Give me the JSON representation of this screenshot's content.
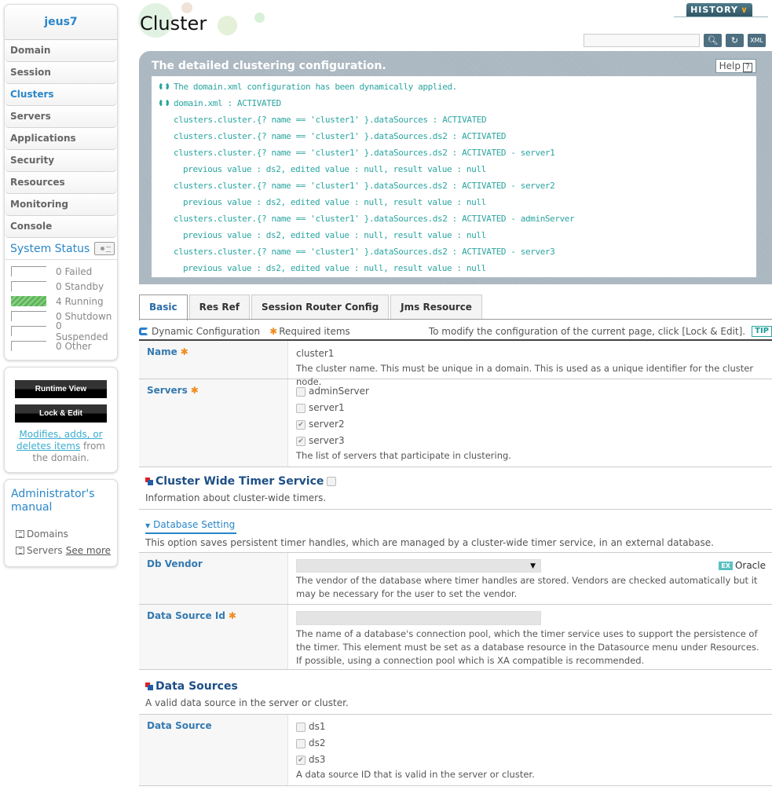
{
  "sidebar": {
    "domain_name": "jeus7",
    "nav": [
      {
        "label": "Domain",
        "active": false
      },
      {
        "label": "Session",
        "active": false
      },
      {
        "label": "Clusters",
        "active": true
      },
      {
        "label": "Servers",
        "active": false
      },
      {
        "label": "Applications",
        "active": false
      },
      {
        "label": "Security",
        "active": false
      },
      {
        "label": "Resources",
        "active": false
      },
      {
        "label": "Monitoring",
        "active": false
      },
      {
        "label": "Console",
        "active": false
      }
    ],
    "system_status": {
      "title": "System Status",
      "items": [
        {
          "count": "0",
          "label": "Failed"
        },
        {
          "count": "0",
          "label": "Standby"
        },
        {
          "count": "4",
          "label": "Running"
        },
        {
          "count": "0",
          "label": "Shutdown"
        },
        {
          "count": "0",
          "label": "Suspended"
        },
        {
          "count": "0",
          "label": "Other"
        }
      ]
    },
    "runtime_view_label": "Runtime View",
    "lock_edit_label": "Lock & Edit",
    "modify_note_link": "Modifies, adds, or deletes items",
    "modify_note_rest": " from the domain.",
    "manual": {
      "title": "Administrator's manual",
      "links": [
        "Domains",
        "Servers"
      ],
      "see_more": "See more"
    }
  },
  "header": {
    "title": "Cluster",
    "history_label": "HISTORY",
    "search_value": ""
  },
  "info_panel": {
    "title": "The detailed clustering configuration.",
    "help_label": "Help",
    "lines": [
      {
        "indent": 0,
        "icon": true,
        "text": "The domain.xml configuration has been dynamically applied."
      },
      {
        "indent": 0,
        "icon": true,
        "text": "domain.xml : ACTIVATED"
      },
      {
        "indent": 1,
        "icon": false,
        "text": "clusters.cluster.{? name == 'cluster1' }.dataSources : ACTIVATED"
      },
      {
        "indent": 1,
        "icon": false,
        "text": "clusters.cluster.{? name == 'cluster1' }.dataSources.ds2 : ACTIVATED"
      },
      {
        "indent": 1,
        "icon": false,
        "text": "clusters.cluster.{? name == 'cluster1' }.dataSources.ds2 : ACTIVATED - server1"
      },
      {
        "indent": 2,
        "icon": false,
        "text": "previous value : ds2, edited value : null, result value : null"
      },
      {
        "indent": 1,
        "icon": false,
        "text": "clusters.cluster.{? name == 'cluster1' }.dataSources.ds2 : ACTIVATED - server2"
      },
      {
        "indent": 2,
        "icon": false,
        "text": "previous value : ds2, edited value : null, result value : null"
      },
      {
        "indent": 1,
        "icon": false,
        "text": "clusters.cluster.{? name == 'cluster1' }.dataSources.ds2 : ACTIVATED - adminServer"
      },
      {
        "indent": 2,
        "icon": false,
        "text": "previous value : ds2, edited value : null, result value : null"
      },
      {
        "indent": 1,
        "icon": false,
        "text": "clusters.cluster.{? name == 'cluster1' }.dataSources.ds2 : ACTIVATED - server3"
      },
      {
        "indent": 2,
        "icon": false,
        "text": "previous value : ds2, edited value : null, result value : null"
      }
    ]
  },
  "tabs": [
    {
      "label": "Basic",
      "active": true
    },
    {
      "label": "Res Ref",
      "active": false
    },
    {
      "label": "Session Router Config",
      "active": false
    },
    {
      "label": "Jms Resource",
      "active": false
    }
  ],
  "legend": {
    "dynamic": "Dynamic Configuration",
    "required": "Required items",
    "tip_text": "To modify the configuration of the current page, click [Lock & Edit].",
    "tip_badge": "TIP"
  },
  "form": {
    "name": {
      "label": "Name",
      "value": "cluster1",
      "desc": "The cluster name. This must be unique in a domain. This is used as a unique identifier for the cluster node."
    },
    "servers": {
      "label": "Servers",
      "options": [
        {
          "label": "adminServer",
          "checked": false
        },
        {
          "label": "server1",
          "checked": false
        },
        {
          "label": "server2",
          "checked": true
        },
        {
          "label": "server3",
          "checked": true
        }
      ],
      "desc": "The list of servers that participate in clustering."
    },
    "timer_service": {
      "title": "Cluster Wide Timer Service",
      "checked": false,
      "desc": "Information about cluster-wide timers."
    },
    "database_setting": {
      "title": "Database Setting",
      "desc": "This option saves persistent timer handles, which are managed by a cluster-wide timer service, in an external database."
    },
    "db_vendor": {
      "label": "Db Vendor",
      "selected": "",
      "example_badge": "EX",
      "example_value": "Oracle",
      "desc": "The vendor of the database where timer handles are stored. Vendors are checked automatically but it may be necessary for the user to set the vendor."
    },
    "data_source_id": {
      "label": "Data Source Id",
      "value": "",
      "desc": "The name of a database's connection pool, which the timer service uses to support the persistence of the timer. This element must be set as a database resource in the Datasource menu under Resources. If possible, using a connection pool which is XA compatible is recommended."
    },
    "data_sources_section": {
      "title": "Data Sources",
      "desc": "A valid data source in the server or cluster."
    },
    "data_source": {
      "label": "Data Source",
      "options": [
        {
          "label": "ds1",
          "checked": false
        },
        {
          "label": "ds2",
          "checked": false
        },
        {
          "label": "ds3",
          "checked": true
        }
      ],
      "desc": "A data source ID that is valid in the server or cluster."
    }
  }
}
